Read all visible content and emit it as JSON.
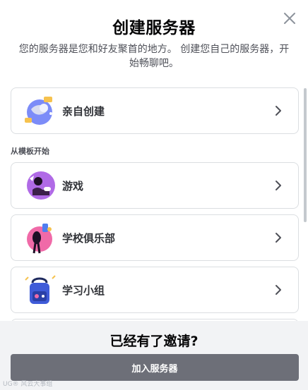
{
  "modal": {
    "title": "创建服务器",
    "subtitle": "您的服务器是您和好友聚首的地方。 创建您自己的服务器，开始畅聊吧。"
  },
  "create_own": {
    "label": "亲自创建",
    "icon": "globe-icon"
  },
  "templates": {
    "section_label": "从模板开始",
    "items": [
      {
        "label": "游戏",
        "icon": "gaming-icon"
      },
      {
        "label": "学校俱乐部",
        "icon": "school-club-icon"
      },
      {
        "label": "学习小组",
        "icon": "study-group-icon"
      }
    ]
  },
  "footer": {
    "title": "已经有了邀请?",
    "join_label": "加入服务器"
  },
  "watermark": "UG® 风云大事组",
  "colors": {
    "button": "#6d6f78",
    "footer_bg": "#f2f3f5",
    "border": "#dbdee1"
  }
}
